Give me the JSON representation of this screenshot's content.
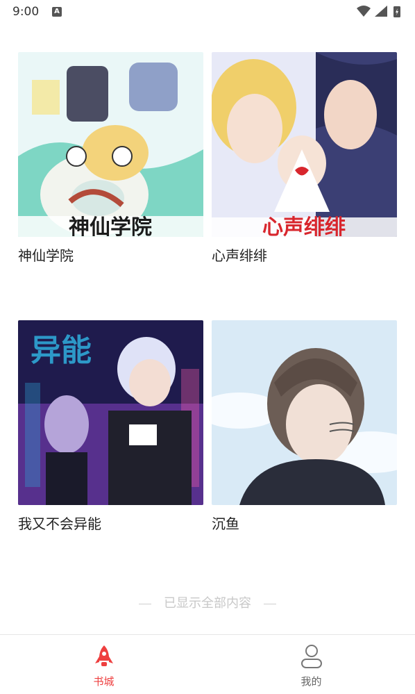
{
  "status_bar": {
    "time": "9:00",
    "notification_badge": "A"
  },
  "books": [
    {
      "title": "神仙学院",
      "cover_text": "神仙学院",
      "palette": [
        "#eaf7f7",
        "#7ed6c4",
        "#f3d37b",
        "#b34b3a"
      ]
    },
    {
      "title": "心声绯绯",
      "cover_text": "心声绯绯",
      "palette": [
        "#e7e9f7",
        "#3b3f74",
        "#f2d6c6",
        "#d8262d"
      ]
    },
    {
      "title": "我又不会异能",
      "cover_text": "异能",
      "palette": [
        "#1f1b4d",
        "#7d3fb9",
        "#2fa7d6",
        "#ff5fa8"
      ]
    },
    {
      "title": "沉鱼",
      "cover_text": "",
      "palette": [
        "#d9eaf6",
        "#f7fbff",
        "#6c5d55",
        "#2a2d3a"
      ]
    }
  ],
  "footer_note": "已显示全部内容",
  "tabs": [
    {
      "label": "书城",
      "icon": "rocket-icon",
      "active": true,
      "color": "#ee3f3f"
    },
    {
      "label": "我的",
      "icon": "user-icon",
      "active": false,
      "color": "#777777"
    }
  ]
}
